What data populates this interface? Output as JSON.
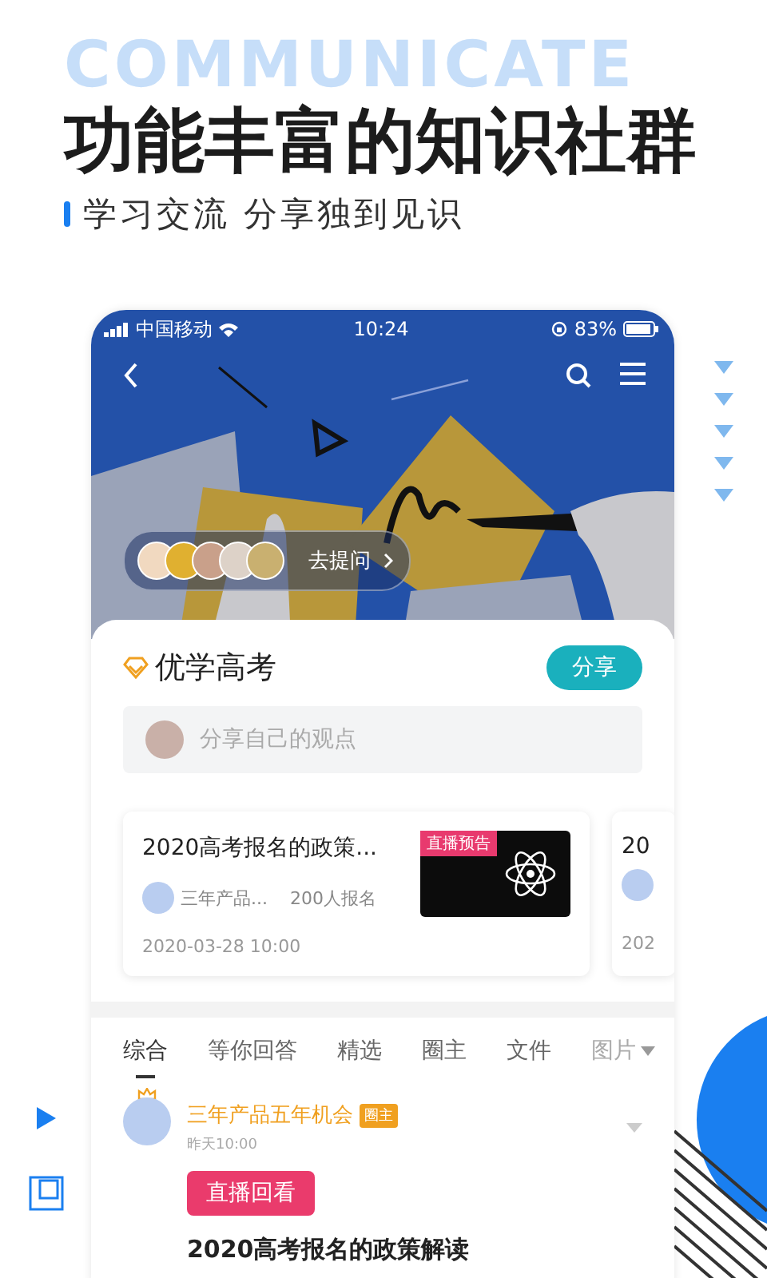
{
  "hero": {
    "watermark_word": "COMMUNICATE",
    "title": "功能丰富的知识社群",
    "subtitle": "学习交流 分享独到见识"
  },
  "status_bar": {
    "carrier": "中国移动",
    "time": "10:24",
    "battery": "83%"
  },
  "banner": {
    "ask_label": "去提问"
  },
  "group": {
    "name": "优学高考",
    "share_button": "分享",
    "post_placeholder": "分享自己的观点"
  },
  "live_cards": [
    {
      "title": "2020高考报名的政策...",
      "author": "三年产品...",
      "signups": "200人报名",
      "time": "2020-03-28 10:00",
      "badge": "直播预告"
    },
    {
      "title": "20",
      "time": "202"
    }
  ],
  "tabs": [
    {
      "label": "综合",
      "selected": true,
      "has_menu": false
    },
    {
      "label": "等你回答",
      "selected": false,
      "has_menu": false
    },
    {
      "label": "精选",
      "selected": false,
      "has_menu": false
    },
    {
      "label": "圈主",
      "selected": false,
      "has_menu": false
    },
    {
      "label": "文件",
      "selected": false,
      "has_menu": false
    },
    {
      "label": "图片",
      "selected": false,
      "has_menu": true
    }
  ],
  "post": {
    "author": "三年产品五年机会",
    "role_badge": "圈主",
    "time": "昨天10:00",
    "replay_button": "直播回看",
    "text": "2020高考报名的政策解读"
  }
}
